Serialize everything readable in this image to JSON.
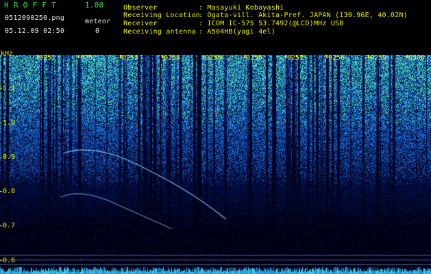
{
  "app": {
    "name": "HROFFT",
    "version": "1.00"
  },
  "file": {
    "name": "0512090250.png",
    "datetime": "05.12.09 02:50"
  },
  "meteor": {
    "label": "meteor",
    "count": "0"
  },
  "info": {
    "observer_label": "Observer",
    "observer_value": ": Masayuki Kobayashi",
    "location_label": "Receiving Location",
    "location_value": ": Ogata-vill. Akita-Pref. JAPAN (139.96E, 40.02N)",
    "receiver_label": "Receiver",
    "receiver_value": ": ICOM IC-575 53.7492(@LCD)MHz USB",
    "antenna_label": "Receiving antenna",
    "antenna_value": ": A504HB(yagi 4el)"
  },
  "axis": {
    "freq_unit": "kHz",
    "freq_ticks": [
      "1.1",
      "1.0",
      "0.9",
      "0.8",
      "0.7",
      "0.6"
    ],
    "time_ticks": [
      "0251",
      "0252",
      "0253",
      "0254",
      "0255",
      "0256",
      "0257",
      "0258",
      "0259",
      "0300"
    ]
  },
  "colors": {
    "background": "#000000",
    "label_yellow": "#f4f000",
    "label_green": "#3fe03f",
    "label_white": "#e8e8e8",
    "noise_blue": "#2a55c8",
    "noise_cyan": "#3ec8e0",
    "noise_green": "#40d890"
  }
}
